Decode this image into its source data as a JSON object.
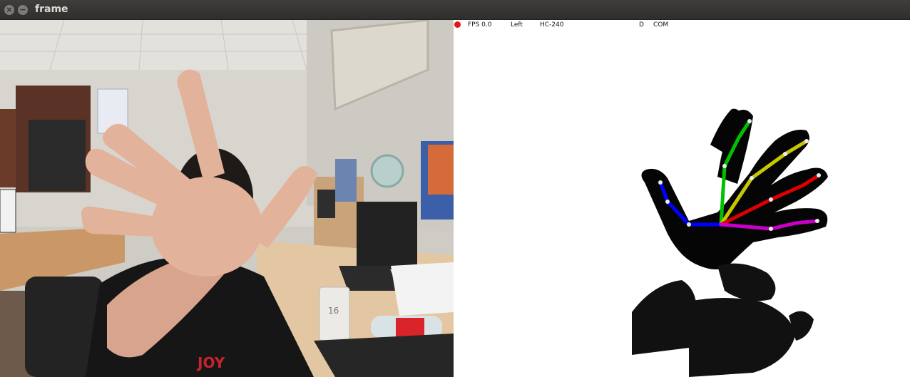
{
  "window": {
    "title": "frame",
    "close_glyph": "×",
    "minimize_glyph": "−"
  },
  "hud": {
    "indicator_color": "#e81414",
    "fps": "FPS 0.0",
    "hand": "Left",
    "gesture": "HC-240",
    "mode": "D",
    "com": "COM"
  },
  "camera": {
    "mug_label": "16",
    "shirt_text": "JOY"
  },
  "skeleton": {
    "colors": {
      "thumb": "#0000ff",
      "index": "#00c000",
      "middle": "#c8c800",
      "ring": "#dd0000",
      "pinky": "#c800c8"
    }
  }
}
